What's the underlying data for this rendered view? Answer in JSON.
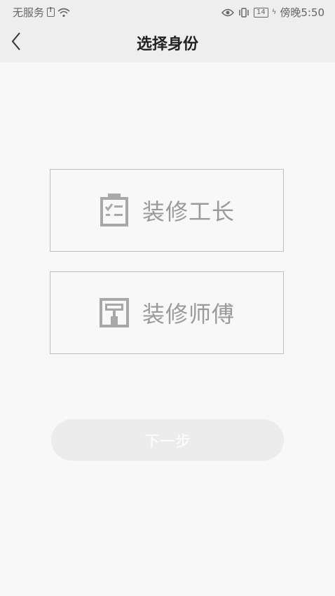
{
  "status_bar": {
    "carrier": "无服务",
    "battery": "14",
    "time": "傍晚5:50"
  },
  "nav": {
    "title": "选择身份",
    "back_icon": "chevron-left-icon"
  },
  "options": [
    {
      "label": "装修工长",
      "icon": "clipboard-checklist-icon"
    },
    {
      "label": "装修师傅",
      "icon": "paint-roller-icon"
    }
  ],
  "next_button": {
    "label": "下一步"
  },
  "colors": {
    "header_bg": "#eeeeee",
    "page_bg": "#f8f8f8",
    "card_border": "#bdbdbd",
    "card_text": "#9a9a9a",
    "button_bg": "#ececec"
  }
}
